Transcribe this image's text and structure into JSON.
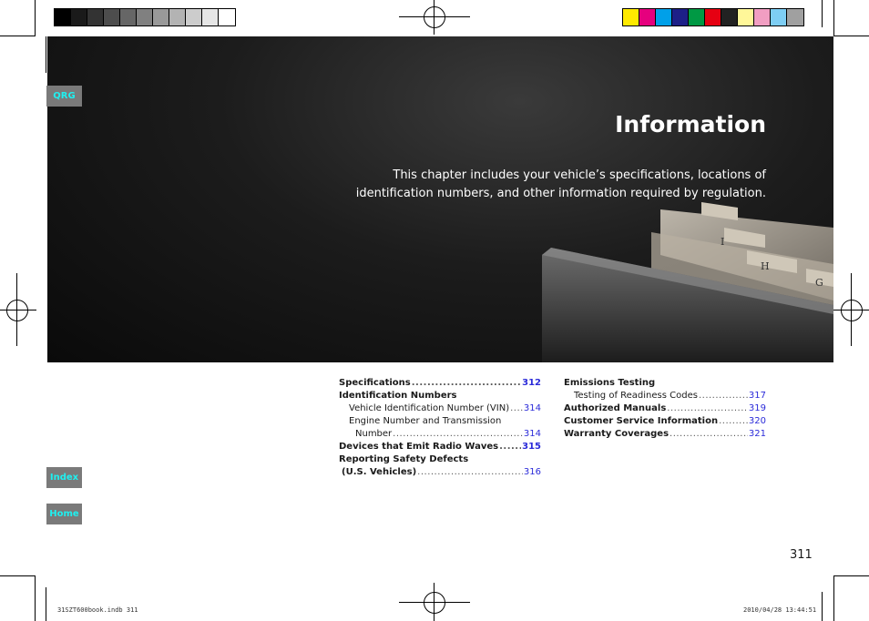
{
  "slug": {
    "file": "31SZT600book.indb   311",
    "datetime": "2010/04/28   13:44:51"
  },
  "color_bars": {
    "gray": [
      "#000000",
      "#1a1a1a",
      "#333333",
      "#4d4d4d",
      "#666666",
      "#808080",
      "#999999",
      "#b3b3b3",
      "#cccccc",
      "#e6e6e6",
      "#ffffff"
    ],
    "color": [
      "#ffea00",
      "#e6007e",
      "#00a0e9",
      "#1d2088",
      "#009944",
      "#e60012",
      "#222222",
      "#fff799",
      "#f19ec2",
      "#7ecef4",
      "#a0a0a0"
    ]
  },
  "side_tabs": {
    "qrg": "QRG",
    "index": "Index",
    "home": "Home"
  },
  "hero": {
    "title": "Information",
    "description": "This chapter includes your vehicle’s specifications, locations of identification numbers, and other information required by regulation.",
    "tab_letters": [
      "I",
      "H",
      "G"
    ]
  },
  "toc_left": {
    "specifications": {
      "label": "Specifications",
      "page": "312"
    },
    "identification_numbers": {
      "label": "Identification Numbers"
    },
    "vin": {
      "label": "Vehicle Identification Number (VIN)",
      "page": "314"
    },
    "engine_line1": {
      "label": "Engine Number and Transmission"
    },
    "engine_line2": {
      "label": "Number",
      "page": "314"
    },
    "devices": {
      "label": "Devices that Emit Radio Waves",
      "page": "315"
    },
    "reporting_line1": {
      "label": "Reporting Safety Defects"
    },
    "reporting_line2": {
      "label": "(U.S. Vehicles)",
      "page": "316"
    }
  },
  "toc_right": {
    "emissions": {
      "label": "Emissions Testing"
    },
    "readiness": {
      "label": "Testing of Readiness Codes",
      "page": "317"
    },
    "manuals": {
      "label": "Authorized Manuals",
      "page": "319"
    },
    "customer": {
      "label": "Customer Service Information",
      "page": "320"
    },
    "warranty": {
      "label": "Warranty Coverages",
      "page": "321"
    }
  },
  "page_number": "311"
}
